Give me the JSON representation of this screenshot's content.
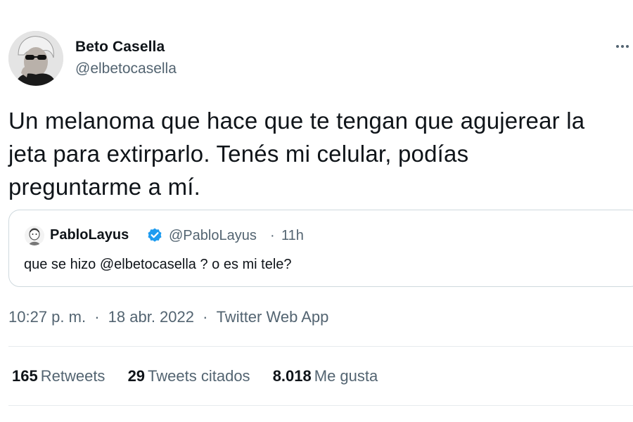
{
  "author": {
    "name": "Beto Casella",
    "handle": "@elbetocasella",
    "avatar_icon": "user-avatar-photo"
  },
  "more_icon": "more-horizontal-icon",
  "tweet_text": "Un melanoma que hace que te tengan que agujerear la\njeta para extirparlo. Tenés mi celular, podías\npreguntarme a mí.",
  "quote": {
    "name": "PabloLayus",
    "verified_icon": "verified-badge-icon",
    "handle": "@PabloLayus",
    "separator": "·",
    "time": "11h",
    "text": "que se hizo @elbetocasella ? o es mi tele?"
  },
  "meta": {
    "time": "10:27 p. m.",
    "date": "18 abr. 2022",
    "source": "Twitter Web App",
    "separator": "·"
  },
  "stats": [
    {
      "value": "165",
      "label": "Retweets"
    },
    {
      "value": "29",
      "label": "Tweets citados"
    },
    {
      "value": "8.018",
      "label": "Me gusta"
    }
  ],
  "colors": {
    "text": "#0f1419",
    "secondary": "#536471",
    "verified": "#1d9bf0",
    "border": "#cfd9de"
  }
}
